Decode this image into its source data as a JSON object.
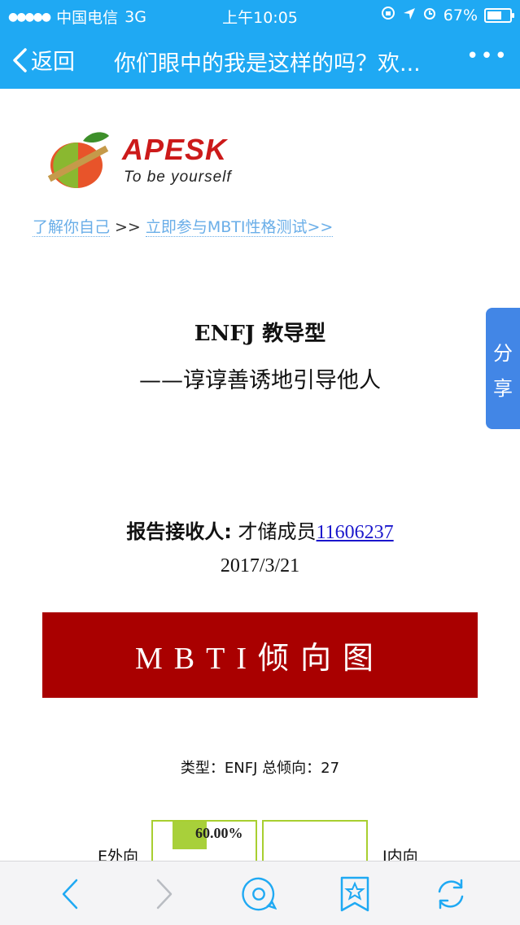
{
  "status_bar": {
    "carrier": "中国电信",
    "network": "3G",
    "time": "上午10:05",
    "battery_percent": "67%",
    "battery_level": 0.67
  },
  "nav": {
    "back_label": "返回",
    "title": "你们眼中的我是这样的吗？欢...",
    "more_label": "•••"
  },
  "logo": {
    "brand": "APESK",
    "tagline": "To be yourself"
  },
  "breadcrumb": {
    "link1": "了解你自己",
    "separator": ">>",
    "link2": "立即参与MBTI性格测试>>"
  },
  "report": {
    "type_title": "ENFJ 教导型",
    "subtitle": "——谆谆善诱地引导他人",
    "recipient_label": "报告接收人:",
    "recipient_name": " 才储成员",
    "recipient_id": "11606237",
    "date": "2017/3/21"
  },
  "banner": {
    "text": "MBTI倾向图"
  },
  "summary": {
    "text": "类型：ENFJ 总倾向：27"
  },
  "tendency": {
    "left_label": "E外向",
    "right_label": "I内向",
    "left_percent": "60.00%",
    "left_fill": 0.6
  },
  "share_tab": {
    "chars": [
      "分",
      "享"
    ]
  },
  "colors": {
    "header": "#1fa9f3",
    "banner": "#a90000",
    "bar_fill": "#a8d03a",
    "share": "#4286e6",
    "toolbar_icons": "#1fa9f3"
  }
}
